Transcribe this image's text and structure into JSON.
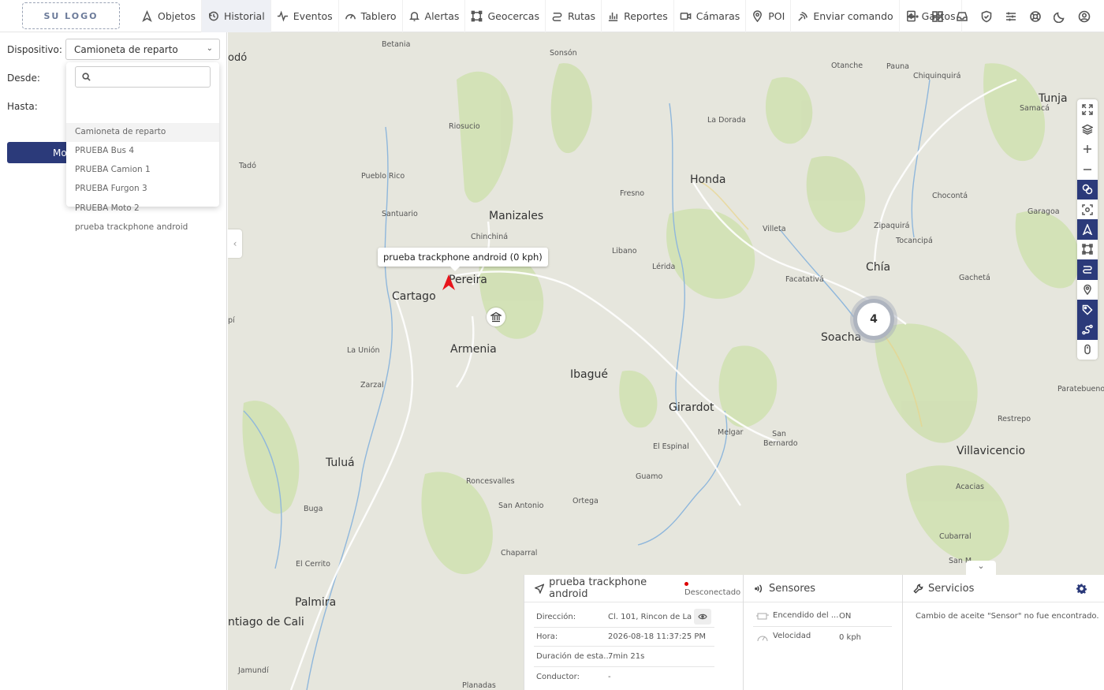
{
  "logo": "SU LOGO",
  "nav": {
    "items": [
      {
        "label": "Objetos",
        "icon": "navigation-arrow-icon"
      },
      {
        "label": "Historial",
        "icon": "history-icon",
        "active": true
      },
      {
        "label": "Eventos",
        "icon": "pulse-icon"
      },
      {
        "label": "Tablero",
        "icon": "gauge-icon"
      },
      {
        "label": "Alertas",
        "icon": "bell-icon"
      },
      {
        "label": "Geocercas",
        "icon": "geofence-icon"
      },
      {
        "label": "Rutas",
        "icon": "route-icon"
      },
      {
        "label": "Reportes",
        "icon": "bar-chart-icon"
      },
      {
        "label": "Cámaras",
        "icon": "camera-icon"
      },
      {
        "label": "POI",
        "icon": "map-pin-icon"
      },
      {
        "label": "Enviar comando",
        "icon": "send-signal-icon"
      },
      {
        "label": "Gastos",
        "icon": "receipt-icon"
      }
    ],
    "right_icons": [
      "more-icon",
      "grid-icon",
      "inbox-icon",
      "shield-icon",
      "sliders-icon",
      "help-icon",
      "moon-icon",
      "user-icon"
    ]
  },
  "form": {
    "device_label": "Dispositivo:",
    "device_value": "Camioneta de reparto",
    "from_label": "Desde:",
    "to_label": "Hasta:",
    "submit_label": "Mo"
  },
  "dropdown": {
    "search_placeholder": "",
    "options": [
      "Camioneta de reparto",
      "PRUEBA Bus 4",
      "PRUEBA Camion 1",
      "PRUEBA Furgon 3",
      "PRUEBA Moto 2",
      "prueba trackphone android"
    ],
    "selected_index": 0
  },
  "map": {
    "cities": [
      "Manizales",
      "Pereira",
      "Cartago",
      "Armenia",
      "Ibagué",
      "Honda",
      "Chía",
      "Soacha",
      "Girardot",
      "Tuluá",
      "Palmira",
      "Villavicencio",
      "Tunja",
      "ntiago de Cali"
    ],
    "towns": [
      "Betania",
      "Sonsón",
      "Otanche",
      "Pauna",
      "Chiquinquirá",
      "Samacá",
      "Riosucio",
      "La Dorada",
      "odó",
      "Tadó",
      "Pueblo Rico",
      "Santuario",
      "Fresno",
      "Chinchiná",
      "Chocontá",
      "Garagoa",
      "Zipaquirá",
      "Tocancipá",
      "Villeta",
      "Libano",
      "Lérida",
      "Facatativá",
      "Gachetá",
      "La Unión",
      "Zarzal",
      "Paratebueno",
      "Restrepo",
      "Melgar",
      "San Bernardo",
      "El Espinal",
      "Roncesvalles",
      "San Antonio",
      "Guamo",
      "Ortega",
      "Acacias",
      "Buga",
      "Chaparral",
      "El Cerrito",
      "Cubarral",
      "Jamundí",
      "Planadas",
      "San M"
    ],
    "tooltip": "prueba trackphone android (0 kph)",
    "cluster_count": "4",
    "toolbar_icons": [
      "fullscreen-icon",
      "layers-icon",
      "zoom-in-icon",
      "zoom-out-icon",
      "shapes-icon",
      "focus-icon",
      "navigation-icon",
      "polygon-icon",
      "routes-icon",
      "pin-icon",
      "tag-icon",
      "path-icon",
      "mouse-icon"
    ]
  },
  "device_panel": {
    "name": "prueba trackphone android",
    "status": "Desconectado",
    "rows": [
      {
        "label": "Dirección:",
        "value": "Cl. 101, Rincon de La P..."
      },
      {
        "label": "Hora:",
        "value": "2026-08-18 11:37:25 PM"
      },
      {
        "label": "Duración de esta...",
        "value": "7min 21s"
      },
      {
        "label": "Conductor:",
        "value": "-"
      }
    ]
  },
  "sensors_panel": {
    "title": "Sensores",
    "rows": [
      {
        "label": "Encendido del ...",
        "value": "ON",
        "icon": "engine-icon"
      },
      {
        "label": "Velocidad",
        "value": "0 kph",
        "icon": "speedometer-icon"
      }
    ]
  },
  "services_panel": {
    "title": "Servicios",
    "rows": [
      {
        "label": "Cambio de aceite",
        "value": "\"Sensor\" no fue encontrado."
      }
    ]
  }
}
